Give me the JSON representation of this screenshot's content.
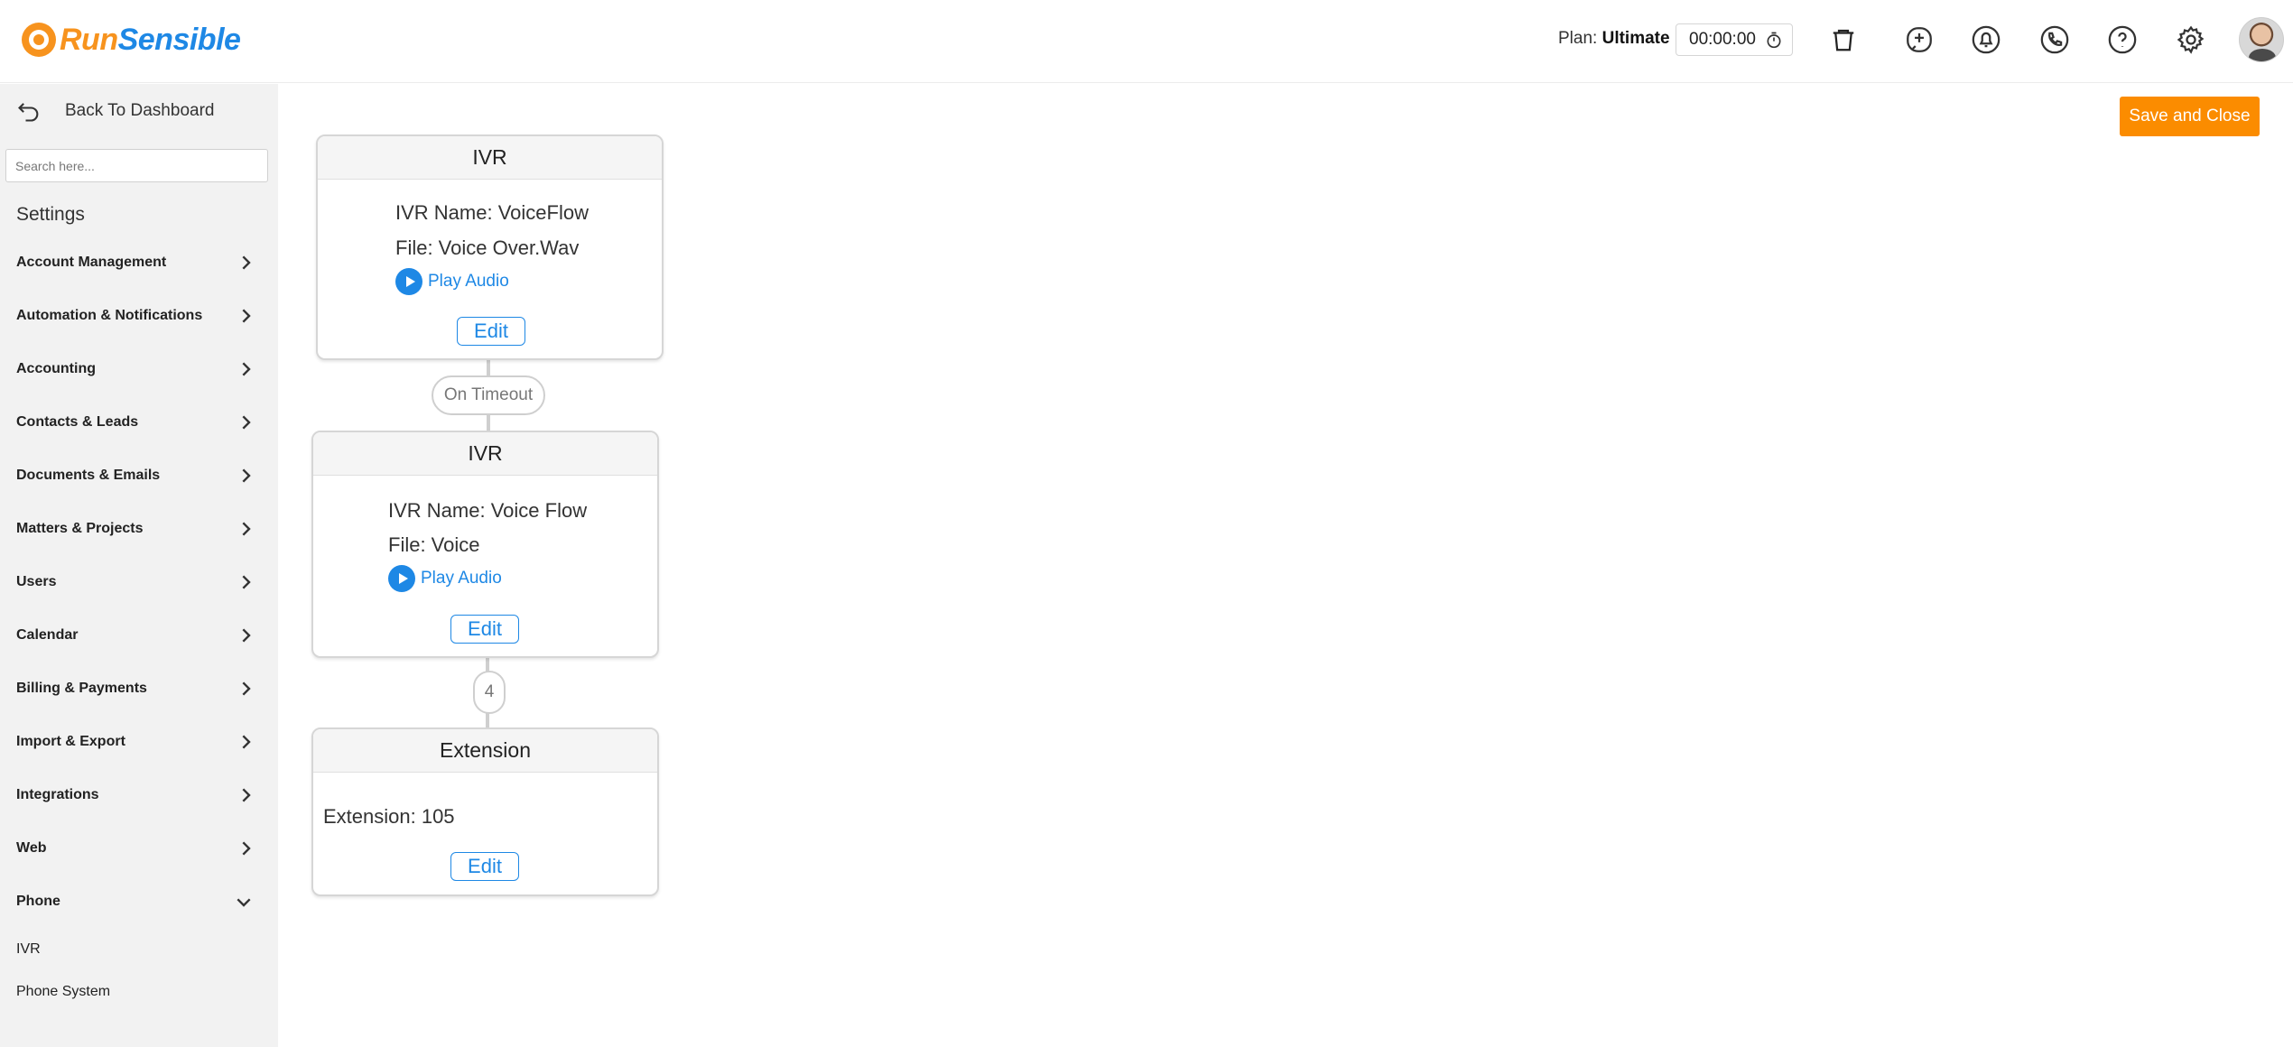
{
  "brand": {
    "part1": "Run",
    "part2": "Sensible"
  },
  "header": {
    "plan_label": "Plan:",
    "plan_value": "Ultimate",
    "timer": "00:00:00",
    "icons": [
      "stopwatch-icon",
      "trash-icon",
      "add-phone-call-icon",
      "bell-icon",
      "phone-icon",
      "help-icon",
      "gear-icon",
      "avatar"
    ]
  },
  "sidebar": {
    "back_label": "Back To Dashboard",
    "search_placeholder": "Search here...",
    "settings_title": "Settings",
    "items": [
      {
        "label": "Account Management"
      },
      {
        "label": "Automation & Notifications"
      },
      {
        "label": "Accounting"
      },
      {
        "label": "Contacts & Leads"
      },
      {
        "label": "Documents & Emails"
      },
      {
        "label": "Matters & Projects"
      },
      {
        "label": "Users"
      },
      {
        "label": "Calendar"
      },
      {
        "label": "Billing & Payments"
      },
      {
        "label": "Import & Export"
      },
      {
        "label": "Integrations"
      },
      {
        "label": "Web"
      },
      {
        "label": "Phone"
      }
    ],
    "phone_children": [
      {
        "label": "IVR"
      },
      {
        "label": "Phone System"
      }
    ]
  },
  "main": {
    "save_label": "Save and Close",
    "flow": {
      "node1": {
        "title": "IVR",
        "name": "IVR Name: VoiceFlow",
        "file": "File: Voice Over.Wav",
        "play": "Play Audio",
        "edit": "Edit"
      },
      "connector1": "On Timeout",
      "node2": {
        "title": "IVR",
        "name": "IVR Name: Voice Flow",
        "file": "File: Voice",
        "play": "Play Audio",
        "edit": "Edit"
      },
      "connector2": "4",
      "node3": {
        "title": "Extension",
        "extension": "Extension: 105",
        "edit": "Edit"
      }
    }
  },
  "colors": {
    "accent_orange": "#fb8c00",
    "link_blue": "#1e88e5",
    "sidebar_bg": "#f2f2f2"
  }
}
